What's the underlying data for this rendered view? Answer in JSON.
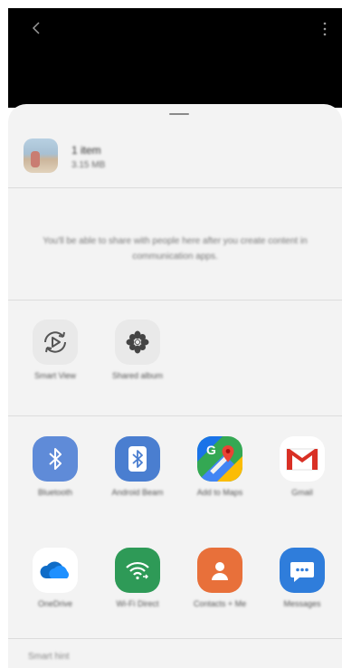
{
  "top_bar": {
    "back_icon": "chevron-left-icon",
    "more_icon": "more-vertical-icon"
  },
  "share_sheet": {
    "file": {
      "name": "1 item",
      "size": "3.15 MB"
    },
    "direct_share_notice": "You'll be able to share with people here after you create content in communication apps.",
    "quick_actions": [
      {
        "label": "Smart View",
        "icon": "smart-view-icon"
      },
      {
        "label": "Shared album",
        "icon": "shared-album-icon"
      }
    ],
    "apps": [
      {
        "label": "Bluetooth",
        "icon": "bluetooth-icon",
        "color": "#5f8bd8"
      },
      {
        "label": "Android Beam",
        "icon": "android-beam-icon",
        "color": "#4a7ed0"
      },
      {
        "label": "Add to Maps",
        "icon": "google-maps-icon",
        "color": "#34a853"
      },
      {
        "label": "Gmail",
        "icon": "gmail-icon",
        "color": "#ea4335"
      },
      {
        "label": "OneDrive",
        "icon": "onedrive-icon",
        "color": "#0f6cc7"
      },
      {
        "label": "Wi-Fi Direct",
        "icon": "wifi-direct-icon",
        "color": "#2e9a57"
      },
      {
        "label": "Contacts + Me",
        "icon": "contacts-icon",
        "color": "#e8703a"
      },
      {
        "label": "Messages",
        "icon": "messages-icon",
        "color": "#2f7ddb"
      }
    ],
    "bottom_section_label": "Smart hint"
  }
}
